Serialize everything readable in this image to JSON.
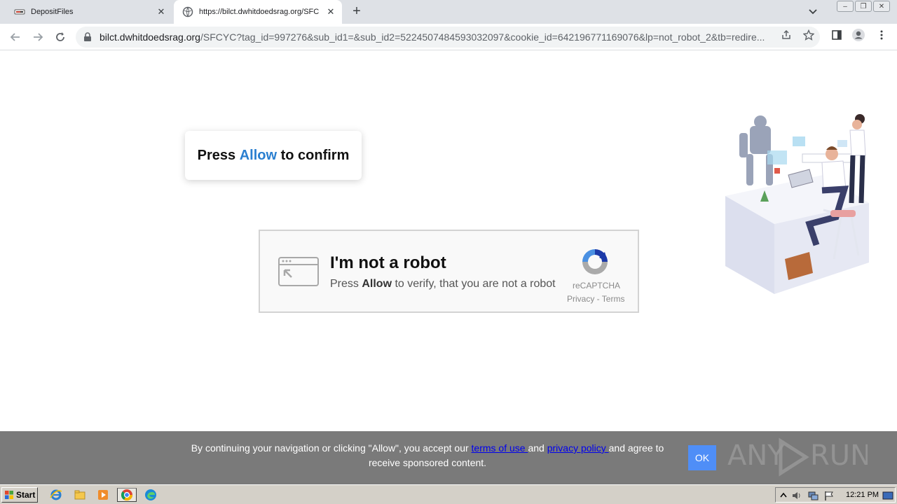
{
  "browser": {
    "tabs": [
      {
        "title": "DepositFiles",
        "active": false
      },
      {
        "title": "https://bilct.dwhitdoedsrag.org/SFC",
        "active": true
      }
    ],
    "new_tab_label": "+",
    "url_host": "bilct.dwhitdoedsrag.org",
    "url_rest": "/SFCYC?tag_id=997276&sub_id1=&sub_id2=5224507484593032097&cookie_id=642196771169076&lp=not_robot_2&tb=redire..."
  },
  "page": {
    "confirm": {
      "prefix": "Press ",
      "highlight": "Allow",
      "suffix": " to confirm"
    },
    "captcha": {
      "title": "I'm not a robot",
      "sub_prefix": "Press ",
      "sub_bold": "Allow",
      "sub_suffix": " to verify, that you are not a robot",
      "brand": "reCAPTCHA",
      "links": "Privacy - Terms"
    }
  },
  "consent": {
    "text_1": "By continuing your navigation or clicking \"Allow\", you accept our ",
    "terms_link": "terms of use ",
    "text_2": "and ",
    "privacy_link": "privacy policy ",
    "text_3": "and agree to receive sponsored content.",
    "ok_label": "OK"
  },
  "watermark": "ANY RUN",
  "taskbar": {
    "start_label": "Start",
    "clock": "12:21 PM"
  },
  "colors": {
    "allow_blue": "#2a7fd0",
    "consent_bg": "#7a7a7a",
    "ok_button": "#4f8ef7"
  }
}
